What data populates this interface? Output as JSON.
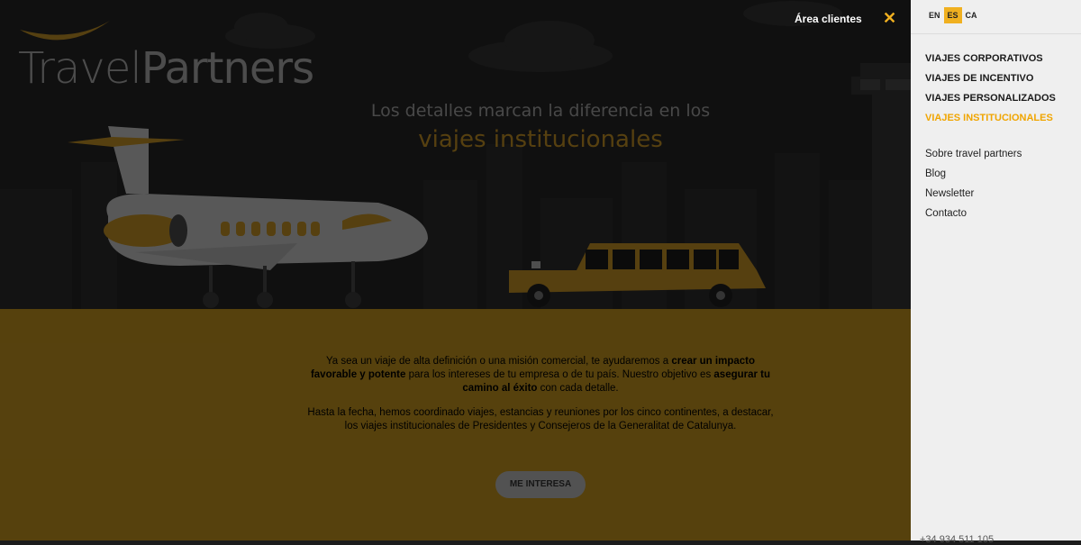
{
  "brand": {
    "name_light": "Travel",
    "name_bold": "Partners"
  },
  "hero": {
    "title": "Los detalles marcan la diferencia en los",
    "subtitle": "viajes institucionales"
  },
  "header": {
    "area_label": "Área clientes",
    "close_symbol": "✕"
  },
  "content": {
    "p1_a": "Ya sea un viaje de alta definición o una misión comercial, te ayudaremos a ",
    "p1_b": "crear un impacto favorable y potente",
    "p1_c": " para los intereses de tu empresa o de tu país. Nuestro objetivo es ",
    "p1_d": "asegurar tu camino al éxito",
    "p1_e": " con cada detalle.",
    "p2": "Hasta la fecha, hemos coordinado viajes, estancias y reuniones por los cinco continentes, a destacar, los viajes institucionales de Presidentes y Consejeros de la Generalitat de Catalunya.",
    "cta": "ME INTERESA"
  },
  "panel": {
    "languages": [
      {
        "code": "EN"
      },
      {
        "code": "ES"
      },
      {
        "code": "CA"
      }
    ],
    "services": [
      {
        "label": "VIAJES CORPORATIVOS"
      },
      {
        "label": "VIAJES DE INCENTIVO"
      },
      {
        "label": "VIAJES PERSONALIZADOS"
      },
      {
        "label": "VIAJES INSTITUCIONALES"
      }
    ],
    "links": [
      {
        "label": "Sobre travel partners"
      },
      {
        "label": "Blog"
      },
      {
        "label": "Newsletter"
      },
      {
        "label": "Contacto"
      }
    ],
    "phone": "+34 934 511 105"
  },
  "colors": {
    "accent": "#f0b020",
    "hero_bg": "#2a2a2a",
    "content_bg": "#e3ac24",
    "panel_bg": "#efefef"
  }
}
